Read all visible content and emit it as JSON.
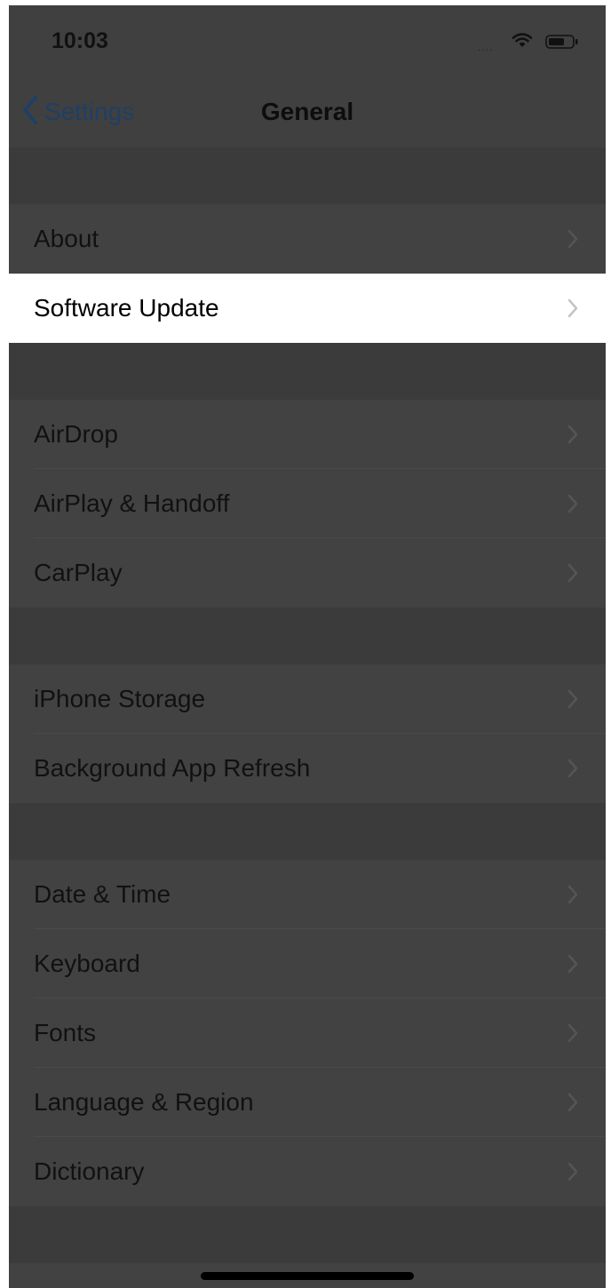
{
  "status_bar": {
    "time": "10:03",
    "signal_dots": "....",
    "icons": [
      "wifi-icon",
      "battery-icon"
    ]
  },
  "nav": {
    "back_label": "Settings",
    "title": "General",
    "back_icon": "chevron-left-icon"
  },
  "groups": [
    {
      "rows": [
        {
          "label": "About",
          "selected": false
        },
        {
          "label": "Software Update",
          "selected": true
        }
      ]
    },
    {
      "rows": [
        {
          "label": "AirDrop",
          "selected": false
        },
        {
          "label": "AirPlay & Handoff",
          "selected": false
        },
        {
          "label": "CarPlay",
          "selected": false
        }
      ]
    },
    {
      "rows": [
        {
          "label": "iPhone Storage",
          "selected": false
        },
        {
          "label": "Background App Refresh",
          "selected": false
        }
      ]
    },
    {
      "rows": [
        {
          "label": "Date & Time",
          "selected": false
        },
        {
          "label": "Keyboard",
          "selected": false
        },
        {
          "label": "Fonts",
          "selected": false
        },
        {
          "label": "Language & Region",
          "selected": false
        },
        {
          "label": "Dictionary",
          "selected": false
        }
      ]
    }
  ],
  "colors": {
    "dimmed_background": "#404040",
    "highlight_row": "#ffffff",
    "back_link": "#1f3f66"
  }
}
